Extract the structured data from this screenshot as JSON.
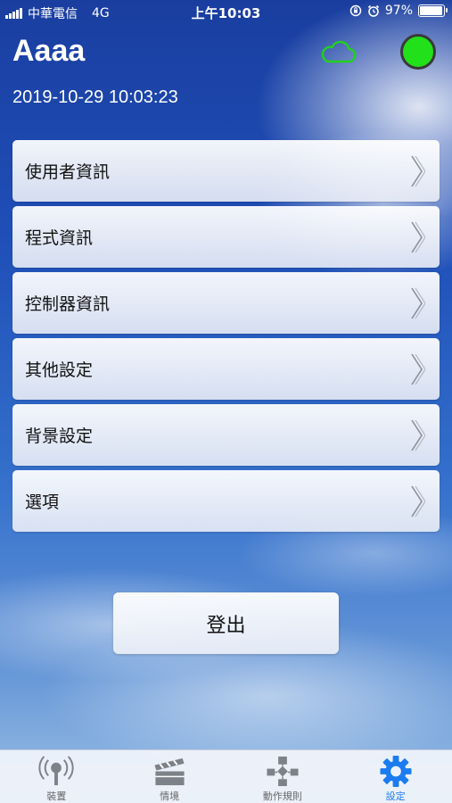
{
  "status_bar": {
    "carrier": "中華電信",
    "network": "4G",
    "time": "上午10:03",
    "battery": "97%",
    "battery_level": 0.97
  },
  "header": {
    "title": "Aaaa",
    "datetime": "2019-10-29 10:03:23",
    "cloud_color": "#22d11c",
    "connection_color": "#22e01a"
  },
  "menu": {
    "items": [
      {
        "label": "使用者資訊"
      },
      {
        "label": "程式資訊"
      },
      {
        "label": "控制器資訊"
      },
      {
        "label": "其他設定"
      },
      {
        "label": "背景設定"
      },
      {
        "label": "選項"
      }
    ]
  },
  "logout_label": "登出",
  "tab_bar": {
    "tabs": [
      {
        "label": "裝置",
        "icon": "device-icon",
        "active": false
      },
      {
        "label": "情境",
        "icon": "scene-icon",
        "active": false
      },
      {
        "label": "動作規則",
        "icon": "rules-icon",
        "active": false
      },
      {
        "label": "設定",
        "icon": "gear-icon",
        "active": true
      }
    ],
    "active_color": "#1a7cf0"
  }
}
